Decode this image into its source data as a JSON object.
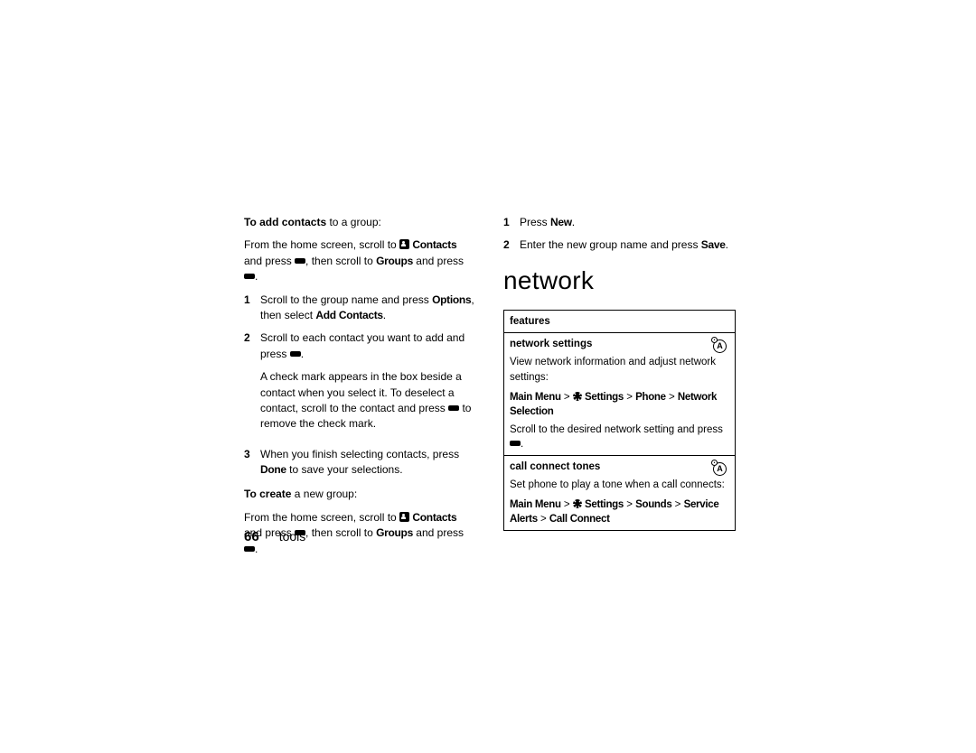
{
  "page_number": "66",
  "footer_label": "tools",
  "left": {
    "intro1_bold": "To add contacts",
    "intro1_rest": " to a group:",
    "intro2_a": "From the home screen, scroll to ",
    "intro2_contacts": "Contacts",
    "intro2_b": " and press ",
    "intro2_c": ", then scroll to ",
    "intro2_groups": "Groups",
    "intro2_d": " and press ",
    "intro2_e": ".",
    "steps": [
      {
        "n": "1",
        "a": "Scroll to the group name and press ",
        "options": "Options",
        "b": ", then select ",
        "addc": "Add Contacts",
        "c": "."
      },
      {
        "n": "2",
        "a": "Scroll to each contact you want to add and press ",
        "b": ".",
        "para2": "A check mark appears in the box beside a contact when you select it. To deselect a contact, scroll to the contact and press ",
        "para2b": " to remove the check mark."
      },
      {
        "n": "3",
        "a": "When you finish selecting contacts, press ",
        "done": "Done",
        "b": " to save your selections."
      }
    ],
    "create_bold": "To create",
    "create_rest": " a new group:",
    "create2_a": "From the home screen, scroll to ",
    "create2_contacts": "Contacts",
    "create2_b": " and press ",
    "create2_c": ", then scroll to ",
    "create2_groups": "Groups",
    "create2_d": " and press ",
    "create2_e": "."
  },
  "right": {
    "steps": [
      {
        "n": "1",
        "a": "Press ",
        "new": "New",
        "b": "."
      },
      {
        "n": "2",
        "a": "Enter the new group name and press ",
        "save": "Save",
        "b": "."
      }
    ],
    "heading": "network",
    "th_features": "features",
    "row1_title": "network settings",
    "row1_text": "View network information and adjust network settings:",
    "row1_path_a": "Main Menu",
    "row1_path_b": "Settings",
    "row1_path_c": "Phone",
    "row1_path_d": "Network Selection",
    "row1_text2a": "Scroll to the desired network setting and press ",
    "row1_text2b": ".",
    "row2_title": "call connect tones",
    "row2_text": "Set phone to play a tone when a call connects:",
    "row2_path_a": "Main Menu",
    "row2_path_b": "Settings",
    "row2_path_c": "Sounds",
    "row2_path_d": "Service Alerts",
    "row2_path_e": "Call Connect"
  }
}
